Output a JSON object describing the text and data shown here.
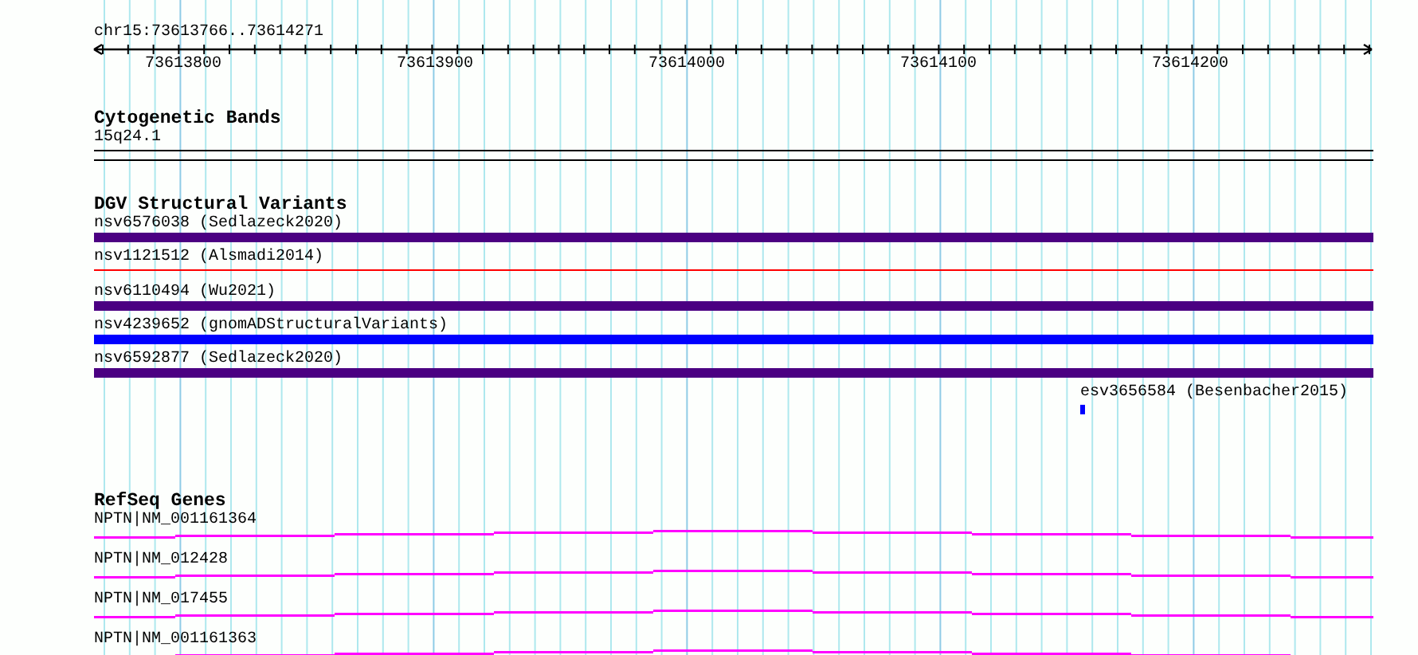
{
  "ruler": {
    "location": "chr15:73613766..73614271",
    "tick_labels": [
      "73613800",
      "73613900",
      "73614000",
      "73614100",
      "73614200"
    ]
  },
  "tracks": [
    {
      "kind": "cytoband",
      "title": "Cytogenetic Bands",
      "label": "15q24.1"
    },
    {
      "kind": "variants",
      "title": "DGV Structural Variants",
      "features": [
        {
          "label": "nsv6576038 (Sedlazeck2020)",
          "kind": "bar",
          "color": "#4b0082"
        },
        {
          "label": "nsv1121512 (Alsmadi2014)",
          "kind": "line",
          "color": "#ff0000"
        },
        {
          "label": "nsv6110494 (Wu2021)",
          "kind": "bar",
          "color": "#4b0082"
        },
        {
          "label": "nsv4239652 (gnomADStructuralVariants)",
          "kind": "bar",
          "color": "#0000ff"
        },
        {
          "label": "nsv6592877 (Sedlazeck2020)",
          "kind": "bar",
          "color": "#4b0082"
        },
        {
          "label": "esv3656584 (Besenbacher2015)",
          "kind": "point",
          "color": "#0000ff"
        }
      ]
    },
    {
      "kind": "genes",
      "title": "RefSeq Genes",
      "features": [
        {
          "label": "NPTN|NM_001161364"
        },
        {
          "label": "NPTN|NM_012428"
        },
        {
          "label": "NPTN|NM_017455"
        },
        {
          "label": "NPTN|NM_001161363"
        }
      ]
    }
  ]
}
